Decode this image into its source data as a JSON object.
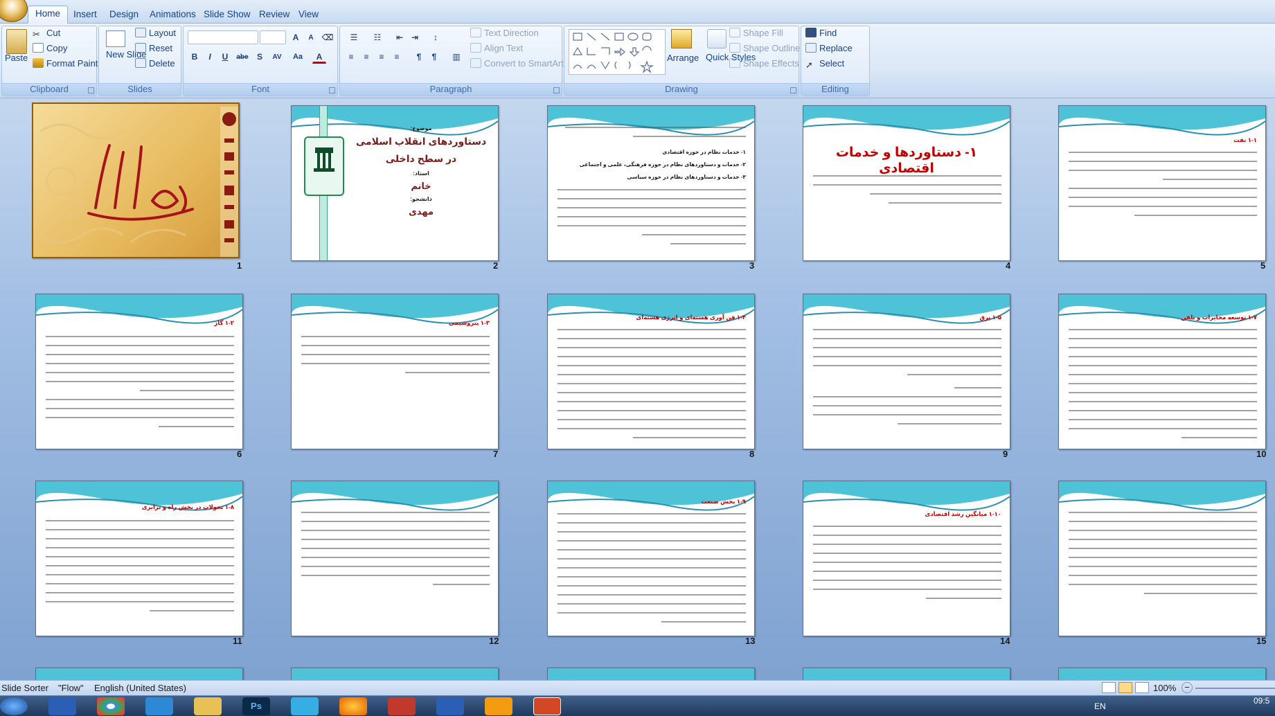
{
  "tabs": [
    "Home",
    "Insert",
    "Design",
    "Animations",
    "Slide Show",
    "Review",
    "View"
  ],
  "clipboard": {
    "paste": "Paste",
    "cut": "Cut",
    "copy": "Copy",
    "format_painter": "Format Painter",
    "label": "Clipboard"
  },
  "slides_group": {
    "new_slide": "New Slide",
    "layout": "Layout",
    "reset": "Reset",
    "delete": "Delete",
    "label": "Slides"
  },
  "font_group": {
    "label": "Font",
    "bold": "B",
    "italic": "I",
    "underline": "U",
    "strike": "abe",
    "shadow": "S",
    "spacing": "AV",
    "case": "Aa",
    "color": "A"
  },
  "paragraph_group": {
    "label": "Paragraph",
    "text_direction": "Text Direction",
    "align_text": "Align Text",
    "convert_smartart": "Convert to SmartArt"
  },
  "drawing_group": {
    "label": "Drawing",
    "arrange": "Arrange",
    "quick_styles": "Quick Styles",
    "shape_fill": "Shape Fill",
    "shape_outline": "Shape Outline",
    "shape_effects": "Shape Effects"
  },
  "editing_group": {
    "label": "Editing",
    "find": "Find",
    "replace": "Replace",
    "select": "Select"
  },
  "slides": [
    {
      "num": "1"
    },
    {
      "num": "2",
      "title_lines": [
        "موضوع:",
        "دستاوردهای انقلاب اسلامی",
        "در سطح داخلی",
        "استاد:",
        "خانم",
        "دانشجو:",
        "مهدی"
      ]
    },
    {
      "num": "3",
      "headings": [
        "۱- خدمات نظام در حوزه اقتصادی",
        "۲- خدمات و دستاوردهای نظام در حوزه فرهنگی، علمی و اجتماعی",
        "۳- خدمات و دستاوردهای نظام در حوزه سیاسی"
      ]
    },
    {
      "num": "4",
      "title": "۱- دستاوردها و خدمات اقتصادی"
    },
    {
      "num": "5",
      "heading": "۱-۱ نفت"
    },
    {
      "num": "6",
      "heading": "۱-۲ گاز"
    },
    {
      "num": "7",
      "heading": "۱-۳ پتروشیمی"
    },
    {
      "num": "8",
      "heading": "۱-۴ فن آوری هسته‌ای و انرژی هسته‌ای"
    },
    {
      "num": "9",
      "heading": "۱-۵ برق"
    },
    {
      "num": "10",
      "heading": "۱-۷ توسعه مخابرات و تلفن"
    },
    {
      "num": "11",
      "heading": "۱-۸ تحولات در بخش راه و ترابری"
    },
    {
      "num": "12",
      "heading": ""
    },
    {
      "num": "13",
      "heading": "۱-۹ بخش صنعت"
    },
    {
      "num": "14",
      "heading": "۱-۱۰ میانگین رشد اقتصادی"
    },
    {
      "num": "15",
      "heading": ""
    }
  ],
  "status": {
    "view": "Slide Sorter",
    "theme": "\"Flow\"",
    "language": "English (United States)",
    "zoom": "100%"
  },
  "clock": "09:5",
  "input_lang": "EN"
}
